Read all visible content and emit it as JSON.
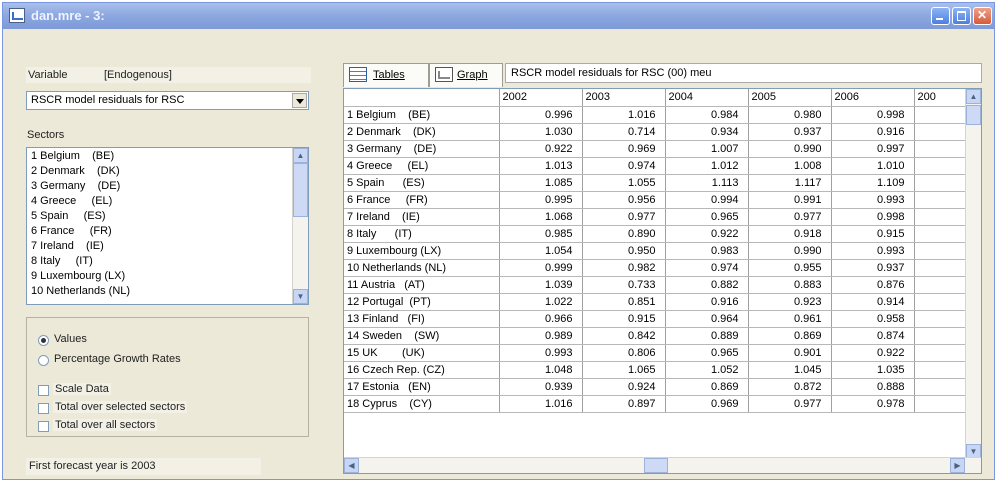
{
  "window": {
    "title": "dan.mre - 3:"
  },
  "left": {
    "variable_label": "Variable",
    "variable_value": "[Endogenous]",
    "selected_variable": "RSCR model residuals for RSC",
    "sectors_label": "Sectors",
    "sectors": [
      "1 Belgium    (BE)",
      "2 Denmark    (DK)",
      "3 Germany    (DE)",
      "4 Greece     (EL)",
      "5 Spain     (ES)",
      "6 France     (FR)",
      "7 Ireland    (IE)",
      "8 Italy     (IT)",
      "9 Luxembourg (LX)",
      "10 Netherlands (NL)"
    ],
    "radios": [
      {
        "label": "Values",
        "selected": true
      },
      {
        "label": "Percentage Growth Rates",
        "selected": false
      }
    ],
    "checks": [
      {
        "label": "Scale Data"
      },
      {
        "label": "Total over selected sectors"
      },
      {
        "label": "Total over all sectors"
      }
    ],
    "forecast_text": "First forecast year is 2003"
  },
  "tabs": [
    {
      "label": "Tables"
    },
    {
      "label": "Graph"
    }
  ],
  "description": "RSCR model residuals for RSC (00) meu",
  "table": {
    "columns": [
      "2002",
      "2003",
      "2004",
      "2005",
      "2006",
      "200"
    ],
    "rows": [
      {
        "name": "1 Belgium    (BE)",
        "values": [
          "0.996",
          "1.016",
          "0.984",
          "0.980",
          "0.998"
        ]
      },
      {
        "name": "2 Denmark    (DK)",
        "values": [
          "1.030",
          "0.714",
          "0.934",
          "0.937",
          "0.916"
        ]
      },
      {
        "name": "3 Germany    (DE)",
        "values": [
          "0.922",
          "0.969",
          "1.007",
          "0.990",
          "0.997"
        ]
      },
      {
        "name": "4 Greece     (EL)",
        "values": [
          "1.013",
          "0.974",
          "1.012",
          "1.008",
          "1.010"
        ]
      },
      {
        "name": "5 Spain      (ES)",
        "values": [
          "1.085",
          "1.055",
          "1.113",
          "1.117",
          "1.109"
        ]
      },
      {
        "name": "6 France     (FR)",
        "values": [
          "0.995",
          "0.956",
          "0.994",
          "0.991",
          "0.993"
        ]
      },
      {
        "name": "7 Ireland    (IE)",
        "values": [
          "1.068",
          "0.977",
          "0.965",
          "0.977",
          "0.998"
        ]
      },
      {
        "name": "8 Italy      (IT)",
        "values": [
          "0.985",
          "0.890",
          "0.922",
          "0.918",
          "0.915"
        ]
      },
      {
        "name": "9 Luxembourg (LX)",
        "values": [
          "1.054",
          "0.950",
          "0.983",
          "0.990",
          "0.993"
        ]
      },
      {
        "name": "10 Netherlands (NL)",
        "values": [
          "0.999",
          "0.982",
          "0.974",
          "0.955",
          "0.937"
        ]
      },
      {
        "name": "11 Austria   (AT)",
        "values": [
          "1.039",
          "0.733",
          "0.882",
          "0.883",
          "0.876"
        ]
      },
      {
        "name": "12 Portugal  (PT)",
        "values": [
          "1.022",
          "0.851",
          "0.916",
          "0.923",
          "0.914"
        ]
      },
      {
        "name": "13 Finland   (FI)",
        "values": [
          "0.966",
          "0.915",
          "0.964",
          "0.961",
          "0.958"
        ]
      },
      {
        "name": "14 Sweden    (SW)",
        "values": [
          "0.989",
          "0.842",
          "0.889",
          "0.869",
          "0.874"
        ]
      },
      {
        "name": "15 UK        (UK)",
        "values": [
          "0.993",
          "0.806",
          "0.965",
          "0.901",
          "0.922"
        ]
      },
      {
        "name": "16 Czech Rep. (CZ)",
        "values": [
          "1.048",
          "1.065",
          "1.052",
          "1.045",
          "1.035"
        ]
      },
      {
        "name": "17 Estonia   (EN)",
        "values": [
          "0.939",
          "0.924",
          "0.869",
          "0.872",
          "0.888"
        ]
      },
      {
        "name": "18 Cyprus    (CY)",
        "values": [
          "1.016",
          "0.897",
          "0.969",
          "0.977",
          "0.978"
        ]
      }
    ]
  }
}
